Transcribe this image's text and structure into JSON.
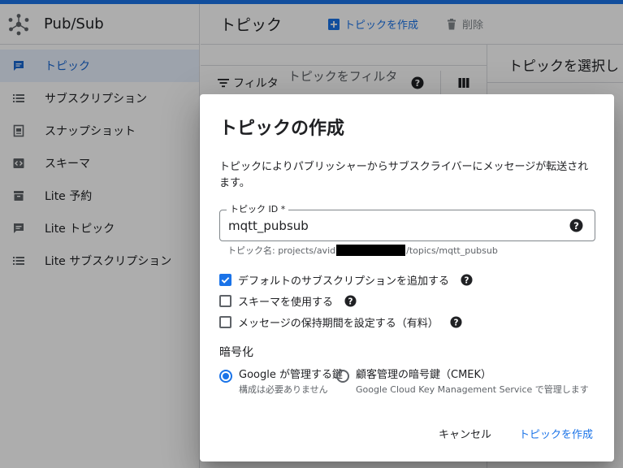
{
  "app": {
    "title": "Pub/Sub"
  },
  "sidebar": {
    "items": [
      {
        "label": "トピック",
        "icon": "topic-icon"
      },
      {
        "label": "サブスクリプション",
        "icon": "list-icon"
      },
      {
        "label": "スナップショット",
        "icon": "snapshot-icon"
      },
      {
        "label": "スキーマ",
        "icon": "schema-icon"
      },
      {
        "label": "Lite 予約",
        "icon": "reservation-icon"
      },
      {
        "label": "Lite トピック",
        "icon": "topic-icon"
      },
      {
        "label": "Lite サブスクリプション",
        "icon": "list-icon"
      }
    ]
  },
  "header": {
    "title": "トピック",
    "create_label": "トピックを作成",
    "delete_label": "削除"
  },
  "filter": {
    "label": "フィルタ",
    "placeholder": "トピックをフィルタ"
  },
  "right_panel": {
    "title": "トピックを選択し"
  },
  "dialog": {
    "title": "トピックの作成",
    "description": "トピックによりパブリッシャーからサブスクライバーにメッセージが転送されます。",
    "field_label": "トピック ID *",
    "field_value": "mqtt_pubsub",
    "hint_prefix": "トピック名: projects/avid",
    "hint_suffix": "/topics/mqtt_pubsub",
    "options": [
      {
        "label": "デフォルトのサブスクリプションを追加する",
        "checked": true
      },
      {
        "label": "スキーマを使用する",
        "checked": false
      },
      {
        "label": "メッセージの保持期間を設定する（有料）",
        "checked": false
      }
    ],
    "encryption_title": "暗号化",
    "encryption": [
      {
        "label": "Google が管理する鍵",
        "desc": "構成は必要ありません",
        "selected": true
      },
      {
        "label": "顧客管理の暗号鍵（CMEK）",
        "desc": "Google Cloud Key Management Service で管理します",
        "selected": false
      }
    ],
    "cancel_label": "キャンセル",
    "create_label": "トピックを作成"
  },
  "colors": {
    "accent": "#1a73e8",
    "active_bg": "#e8f0fe"
  }
}
